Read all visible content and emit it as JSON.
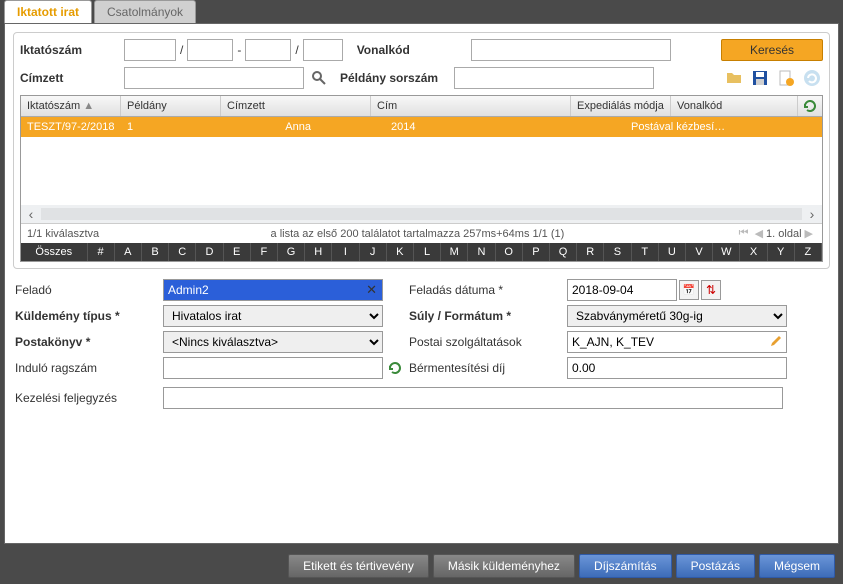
{
  "tabs": {
    "active": "Iktatott irat",
    "inactive": "Csatolmányok"
  },
  "search": {
    "iktatoszam_label": "Iktatószám",
    "vonalkod_label": "Vonalkód",
    "cimzett_label": "Címzett",
    "peldany_sorszam_label": "Példány sorszám",
    "search_btn": "Keresés"
  },
  "table": {
    "headers": {
      "iktatoszam": "Iktatószám",
      "peldany": "Példány",
      "cimzett": "Címzett",
      "cim": "Cím",
      "expedialas": "Expediálás módja",
      "vonalkod": "Vonalkód"
    },
    "row": {
      "iktatoszam": "TESZT/97-2/2018",
      "peldany": "1",
      "cimzett": "Anna",
      "cim": "2014",
      "expedialas": "Postával kézbesí…",
      "vonalkod": ""
    },
    "status_left": "1/1 kiválasztva",
    "status_mid": "a lista az első 200 találatot tartalmazza  257ms+64ms 1/1 (1)",
    "status_page": "1. oldal"
  },
  "alpha": [
    "Összes",
    "#",
    "A",
    "B",
    "C",
    "D",
    "E",
    "F",
    "G",
    "H",
    "I",
    "J",
    "K",
    "L",
    "M",
    "N",
    "O",
    "P",
    "Q",
    "R",
    "S",
    "T",
    "U",
    "V",
    "W",
    "X",
    "Y",
    "Z"
  ],
  "form": {
    "felado_label": "Feladó",
    "felado_value": "Admin2",
    "feladas_datuma_label": "Feladás dátuma *",
    "feladas_datuma_value": "2018-09-04",
    "kuldemeny_tipus_label": "Küldemény típus *",
    "kuldemeny_tipus_value": "Hivatalos irat",
    "suly_label": "Súly / Formátum *",
    "suly_value": "Szabványméretű 30g-ig",
    "postakonyv_label": "Postakönyv *",
    "postakonyv_value": "<Nincs kiválasztva>",
    "postai_szolg_label": "Postai szolgáltatások",
    "postai_szolg_value": "K_AJN, K_TEV",
    "indulo_ragszam_label": "Induló ragszám",
    "bermentesitesi_label": "Bérmentesítési díj",
    "bermentesitesi_value": "0.00",
    "kezelesi_label": "Kezelési feljegyzés"
  },
  "footer": {
    "etikett": "Etikett és tértivevény",
    "masik": "Másik küldeményhez",
    "dijszamitas": "Díjszámítás",
    "postazas": "Postázás",
    "megsem": "Mégsem"
  }
}
